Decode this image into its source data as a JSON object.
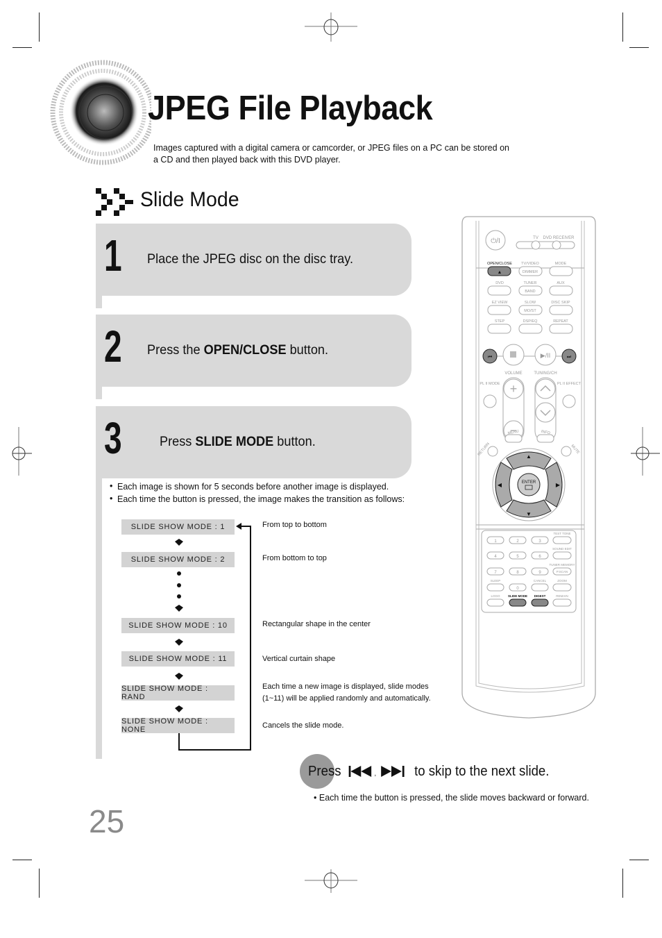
{
  "header": {
    "title": "JPEG File Playback",
    "intro": "Images captured with a digital camera or camcorder, or JPEG files on a PC can be stored on a CD and then played back with this DVD player."
  },
  "section": {
    "title": "Slide Mode"
  },
  "steps": [
    {
      "number": "1",
      "pre": "Place the JPEG disc on the disc tray.",
      "bold": "",
      "post": ""
    },
    {
      "number": "2",
      "pre": "Press the ",
      "bold": "OPEN/CLOSE",
      "post": " button."
    },
    {
      "number": "3",
      "pre": "Press ",
      "bold": "SLIDE MODE",
      "post": " button."
    }
  ],
  "notes": [
    "Each image is shown for 5 seconds before another image is displayed.",
    "Each time the button is pressed, the image makes the transition as follows:"
  ],
  "modes": [
    {
      "label": "SLIDE SHOW MODE : 1",
      "desc": "From top to bottom"
    },
    {
      "label": "SLIDE SHOW MODE : 2",
      "desc": "From bottom to top"
    },
    {
      "label": "SLIDE SHOW MODE : 10",
      "desc": "Rectangular shape in the center"
    },
    {
      "label": "SLIDE SHOW MODE : 11",
      "desc": "Vertical curtain shape"
    },
    {
      "label": "SLIDE SHOW MODE : RAND",
      "desc": "Each time a new image is displayed, slide modes (1~11) will be applied randomly and automatically."
    },
    {
      "label": "SLIDE SHOW MODE : NONE",
      "desc": "Cancels the slide mode."
    }
  ],
  "skip": {
    "pre": "Press",
    "separator": ",",
    "post": "to skip to the next slide.",
    "note": "Each time the button is pressed, the slide moves backward or forward.",
    "icons": [
      "skip-back-icon",
      "skip-forward-icon"
    ]
  },
  "page_number": "25",
  "remote": {
    "top_labels": {
      "tv": "TV",
      "dvd_receiver": "DVD RECEIVER"
    },
    "rows": [
      [
        "OPEN/CLOSE",
        "TV/VIDEO",
        "MODE"
      ],
      [
        "DVD",
        "TUNER",
        "AUX"
      ],
      [
        "EZ VIEW",
        "SLOW",
        "DISC SKIP"
      ],
      [
        "STEP",
        "DSP/EQ",
        "REPEAT"
      ]
    ],
    "sublabels": {
      "dimmer": "DIMMER",
      "band": "BAND",
      "mo_st": "MO/ST"
    },
    "volume": "VOLUME",
    "tuning": "TUNING/CH",
    "pl_mode": "PL II MODE",
    "pl_effect": "PL II EFFECT",
    "menu": "MENU",
    "info": "INFO",
    "return": "RETURN",
    "mute": "MUTE",
    "enter": "ENTER",
    "numpad": [
      "1",
      "2",
      "3",
      "4",
      "5",
      "6",
      "7",
      "8",
      "9",
      "0"
    ],
    "side_labels": [
      "TEST TONE",
      "SOUND EDIT",
      "TUNER MEMORY",
      "ZOOM",
      "REMAIN"
    ],
    "p_scan": "P.SCAN",
    "bottom_labels": [
      "SLEEP",
      "CANCEL",
      "LOGO",
      "SLIDE MODE",
      "DIGEST"
    ],
    "highlight": "#555555"
  }
}
